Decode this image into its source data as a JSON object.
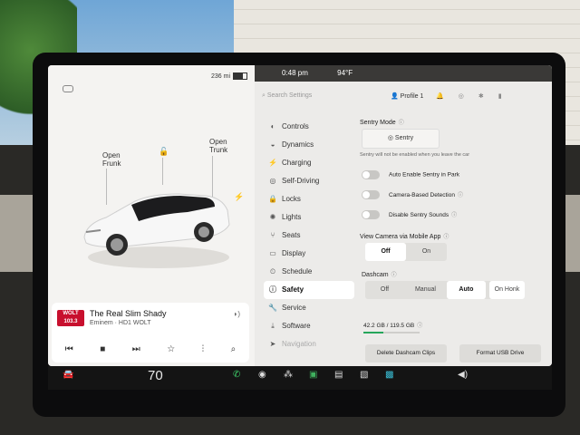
{
  "left": {
    "range": "236 mi",
    "frunk": "Open\nFrunk",
    "trunk": "Open\nTrunk",
    "media": {
      "song": "The Real Slim Shady",
      "artist": "Eminem · HD1 WOLT",
      "logo": "WOLT 103.3",
      "controls": [
        "prev-icon",
        "stop-icon",
        "next-icon",
        "favorite-icon",
        "equalizer-icon",
        "search-icon"
      ]
    }
  },
  "status": {
    "time": "0:48 pm",
    "temp": "94°F"
  },
  "topbar": {
    "search_placeholder": "Search Settings",
    "profile": "Profile 1"
  },
  "nav": [
    {
      "label": "Controls",
      "icon": "toggle-icon"
    },
    {
      "label": "Dynamics",
      "icon": "car-icon"
    },
    {
      "label": "Charging",
      "icon": "bolt-icon"
    },
    {
      "label": "Self-Driving",
      "icon": "steering-icon"
    },
    {
      "label": "Locks",
      "icon": "lock-icon"
    },
    {
      "label": "Lights",
      "icon": "light-icon"
    },
    {
      "label": "Seats",
      "icon": "seat-icon"
    },
    {
      "label": "Display",
      "icon": "display-icon"
    },
    {
      "label": "Schedule",
      "icon": "clock-icon"
    },
    {
      "label": "Safety",
      "icon": "safety-icon"
    },
    {
      "label": "Service",
      "icon": "wrench-icon"
    },
    {
      "label": "Software",
      "icon": "download-icon"
    },
    {
      "label": "Navigation",
      "icon": "nav-icon"
    }
  ],
  "content": {
    "sentry_title": "Sentry Mode",
    "sentry_button": "Sentry",
    "sentry_note": "Sentry will not be enabled when you leave the car",
    "toggles": [
      "Auto Enable Sentry in Park",
      "Camera-Based Detection",
      "Disable Sentry Sounds"
    ],
    "view_camera_title": "View Camera via Mobile App",
    "view_camera_options": [
      "Off",
      "On"
    ],
    "dashcam_title": "Dashcam",
    "dashcam_options": [
      "Off",
      "Manual",
      "Auto",
      "On Honk"
    ],
    "storage": "42.2 GB / 119.5 GB",
    "storage_fraction": 0.35,
    "delete_btn": "Delete Dashcam Clips",
    "format_btn": "Format USB Drive"
  },
  "taskbar": {
    "temp": "70"
  },
  "colors": {
    "accent_green": "#26a65b",
    "alert_orange": "#d98a0d",
    "status_bar": "#3a3937"
  }
}
